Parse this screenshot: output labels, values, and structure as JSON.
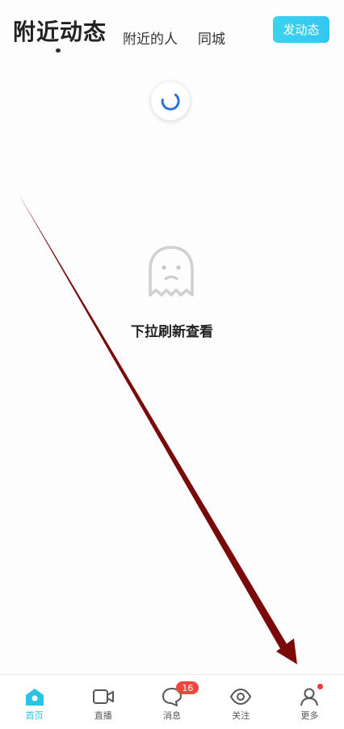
{
  "header": {
    "tabs": [
      "附近动态",
      "附近的人",
      "同城"
    ],
    "post_button": "发动态"
  },
  "empty_state": {
    "message": "下拉刷新查看"
  },
  "bottom_nav": {
    "items": [
      {
        "label": "首页"
      },
      {
        "label": "直播"
      },
      {
        "label": "消息",
        "badge": "16"
      },
      {
        "label": "关注"
      },
      {
        "label": "更多"
      }
    ]
  },
  "colors": {
    "accent": "#29c3e6",
    "badge": "#f2453d",
    "arrow": "#7a0a0a"
  }
}
